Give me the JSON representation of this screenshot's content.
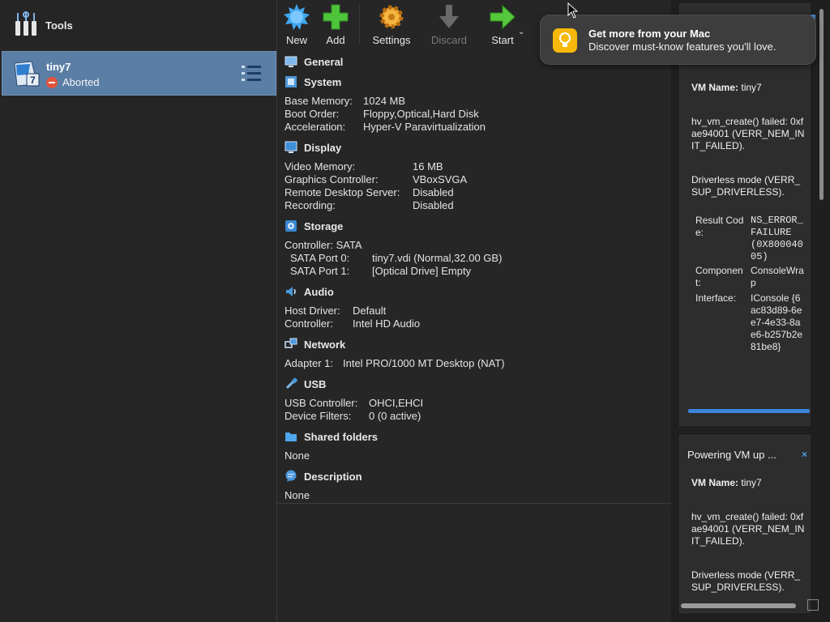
{
  "sidebar": {
    "tools_label": "Tools",
    "vm": {
      "name": "tiny7",
      "state": "Aborted",
      "os_badge": "7"
    }
  },
  "toolbar": {
    "new": "New",
    "add": "Add",
    "settings": "Settings",
    "discard": "Discard",
    "start": "Start"
  },
  "details": {
    "general": {
      "title": "General"
    },
    "system": {
      "title": "System",
      "rows": [
        {
          "k": "Base Memory:",
          "v": "1024 MB"
        },
        {
          "k": "Boot Order:",
          "v": "Floppy,Optical,Hard Disk"
        },
        {
          "k": "Acceleration:",
          "v": "Hyper-V Paravirtualization"
        }
      ]
    },
    "display": {
      "title": "Display",
      "rows": [
        {
          "k": "Video Memory:",
          "v": "16 MB"
        },
        {
          "k": "Graphics Controller:",
          "v": "VBoxSVGA"
        },
        {
          "k": "Remote Desktop Server:",
          "v": "Disabled"
        },
        {
          "k": "Recording:",
          "v": "Disabled"
        }
      ]
    },
    "storage": {
      "title": "Storage",
      "controller": "Controller: SATA",
      "rows": [
        {
          "k": "SATA Port 0:",
          "v": "tiny7.vdi (Normal,32.00 GB)"
        },
        {
          "k": "SATA Port 1:",
          "v": "[Optical Drive] Empty"
        }
      ]
    },
    "audio": {
      "title": "Audio",
      "rows": [
        {
          "k": "Host Driver:",
          "v": "Default"
        },
        {
          "k": "Controller:",
          "v": "Intel HD Audio"
        }
      ]
    },
    "network": {
      "title": "Network",
      "rows": [
        {
          "k": "Adapter 1:",
          "v": "Intel PRO/1000 MT Desktop (NAT)"
        }
      ]
    },
    "usb": {
      "title": "USB",
      "rows": [
        {
          "k": "USB Controller:",
          "v": "OHCI,EHCI"
        },
        {
          "k": "Device Filters:",
          "v": "0 (0 active)"
        }
      ]
    },
    "shared": {
      "title": "Shared folders",
      "value": "None"
    },
    "description": {
      "title": "Description",
      "value": "None"
    }
  },
  "toast": {
    "title": "Get more from your Mac",
    "body": "Discover must-know features you'll love."
  },
  "notifications": {
    "card1": {
      "vm_name_label": "VM Name:",
      "vm_name": "tiny7",
      "error1": "hv_vm_create() failed: 0xfae94001 (VERR_NEM_INIT_FAILED).",
      "error2": "Driverless mode (VERR_SUP_DRIVERLESS).",
      "details": [
        {
          "k": "Result Code:",
          "v": "NS_ERROR_FAILURE (0X80004005)"
        },
        {
          "k": "Component:",
          "v": "ConsoleWrap"
        },
        {
          "k": "Interface:",
          "v": "IConsole {6ac83d89-6ee7-4e33-8ae6-b257b2e81be8}"
        }
      ]
    },
    "card2": {
      "title": "Powering VM up ...",
      "close": "×",
      "vm_name_label": "VM Name:",
      "vm_name": "tiny7",
      "error1": "hv_vm_create() failed: 0xfae94001 (VERR_NEM_INIT_FAILED).",
      "error2": "Driverless mode (VERR_SUP_DRIVERLESS)."
    }
  },
  "colors": {
    "selection": "#5b7ea6",
    "progress": "#3b86d9",
    "aborted": "#e2553c",
    "toast_icon": "#f6b80a"
  }
}
